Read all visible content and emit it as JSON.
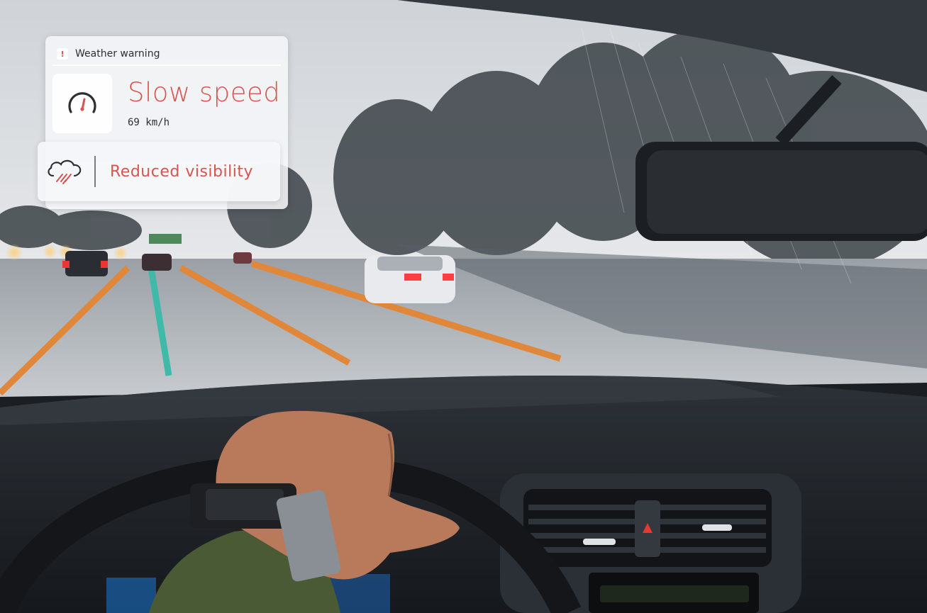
{
  "hud": {
    "header_title": "Weather warning",
    "alert_symbol": "!",
    "speed_warning": "Slow speed",
    "speed_value": "69 km/h",
    "visibility_warning": "Reduced visibility"
  },
  "icons": {
    "alert": "exclamation-badge",
    "gauge": "speedometer-icon",
    "weather": "cloud-rain-icon"
  },
  "colors": {
    "warning_text": "#d9534f",
    "lane_left": "#e0873a",
    "lane_center": "#3fb9a8",
    "lane_right": "#e0873a"
  }
}
